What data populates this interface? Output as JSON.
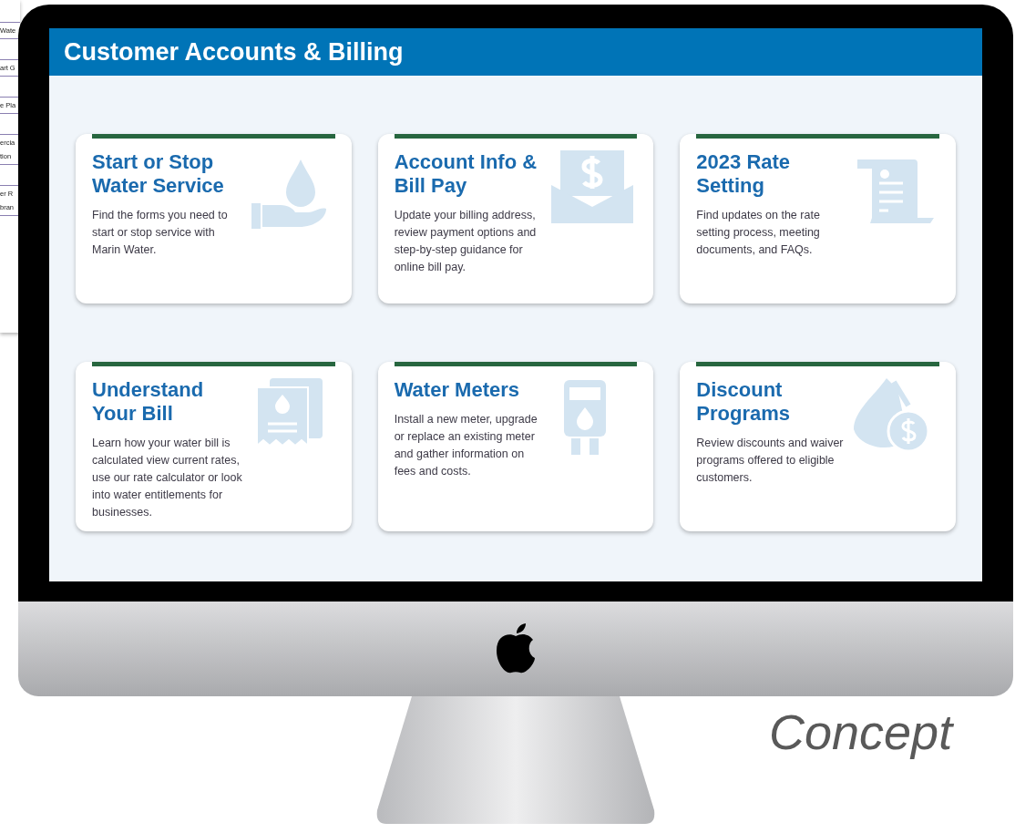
{
  "background_document": {
    "boxes": [
      {
        "lines": [
          "Wate"
        ]
      },
      {
        "lines": [
          "art G"
        ]
      },
      {
        "lines": [
          "e Pla"
        ]
      },
      {
        "lines": [
          "ercia",
          "tion"
        ]
      },
      {
        "lines": [
          "er R",
          "bran"
        ]
      }
    ]
  },
  "screen": {
    "title": "Customer Accounts & Billing",
    "cards": [
      {
        "kind": "hand-drop",
        "title": "Start or Stop Water Service",
        "description": "Find the forms you need to start or stop service with Marin Water."
      },
      {
        "kind": "envelope-dollar",
        "title": "Account Info & Bill Pay",
        "description": "Update your billing address, review payment options and step-by-step guidance for online bill pay."
      },
      {
        "kind": "scroll",
        "title": "2023 Rate Setting",
        "description": "Find updates on the rate setting process, meeting documents, and FAQs."
      },
      {
        "kind": "receipt",
        "title": "Understand Your Bill",
        "description": "Learn how your water bill is calculated view current rates, use our rate calculator or look into water entitlements for businesses."
      },
      {
        "kind": "meter",
        "title": "Water Meters",
        "description": "Install a new meter, upgrade or replace an existing meter and gather information on fees and costs."
      },
      {
        "kind": "drop-coin",
        "title": "Discount Programs",
        "description": "Review discounts and waiver programs offered to eligible customers."
      }
    ]
  },
  "caption": "Concept"
}
